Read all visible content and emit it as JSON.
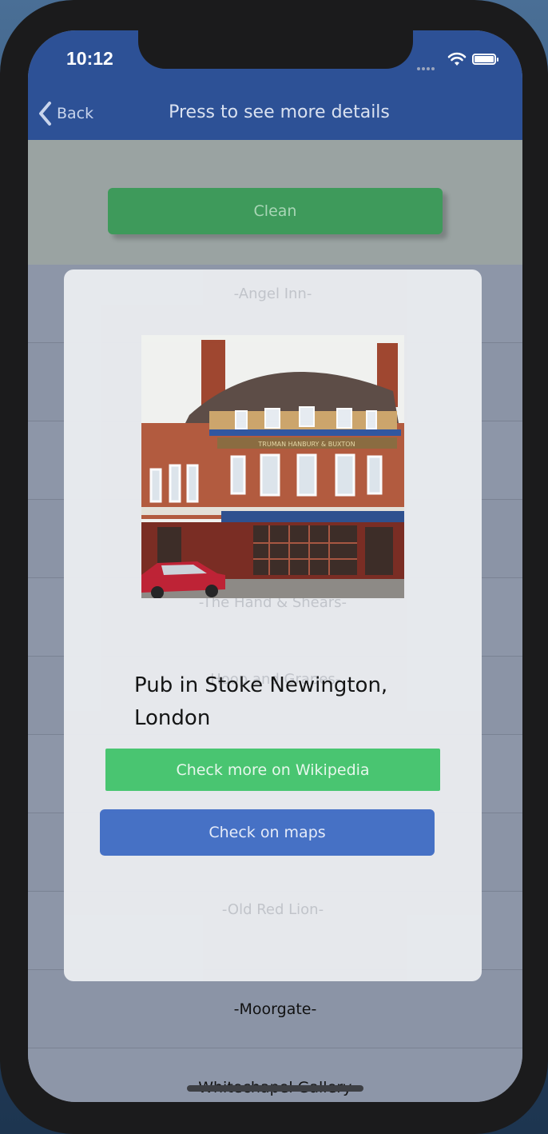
{
  "status_bar": {
    "time": "10:12"
  },
  "navbar": {
    "back_label": "Back",
    "title": "Press to see more details"
  },
  "top": {
    "clean_label": "Clean"
  },
  "list": {
    "items": [
      {
        "label": ""
      },
      {
        "label": ""
      },
      {
        "label": ""
      },
      {
        "label": ""
      },
      {
        "label": ""
      },
      {
        "label": ""
      },
      {
        "label": ""
      },
      {
        "label": ""
      },
      {
        "label": ""
      },
      {
        "label": "-Moorgate-"
      },
      {
        "label": "-Whitechapel Gallery-"
      }
    ]
  },
  "modal": {
    "ghost_labels": [
      "-Angel Inn-",
      "-The Hand & Shears-",
      "-Hoop and Grapes-",
      "-Old Red Lion-"
    ],
    "photo_alt": "TRUMAN HANBURY & BUXTON",
    "description": "Pub in Stoke Newington, London",
    "wiki_label": "Check more on Wikipedia",
    "maps_label": "Check on maps"
  },
  "colors": {
    "navbar": "#2d5196",
    "clean_button": "#3e9a5b",
    "wiki_button": "#47c770",
    "maps_button": "#4470c7"
  }
}
